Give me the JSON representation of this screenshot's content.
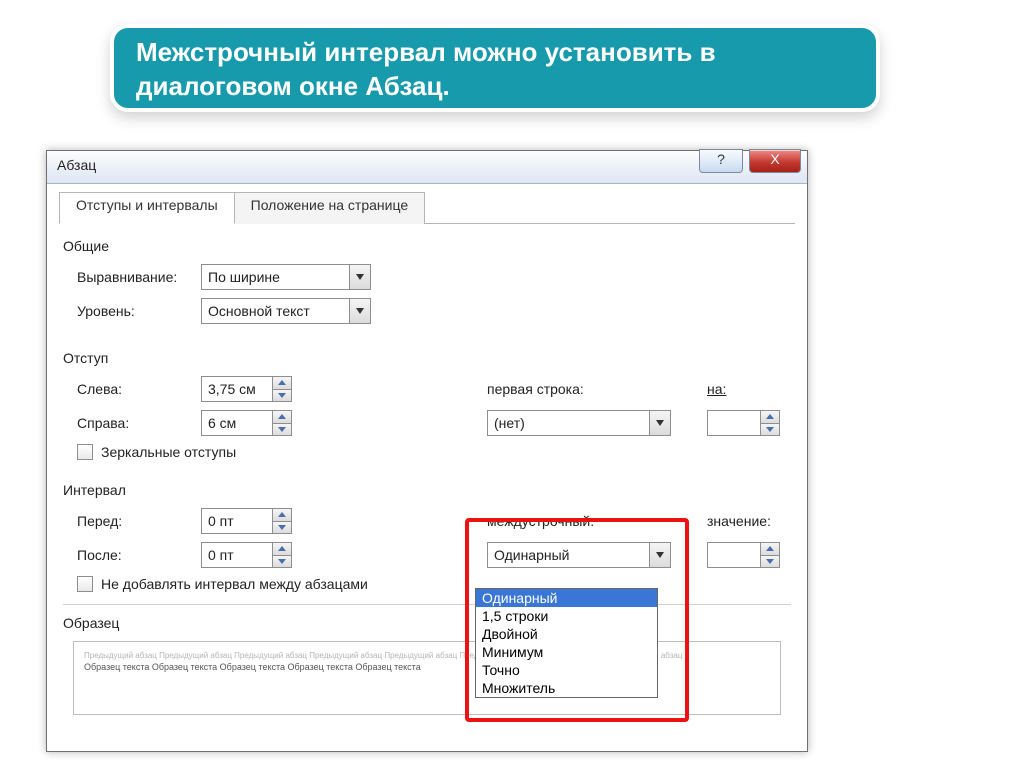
{
  "banner": {
    "text": "Межстрочный интервал можно установить в диалоговом окне Абзац."
  },
  "dialog": {
    "title": "Абзац",
    "help_symbol": "?",
    "close_symbol": "X",
    "tabs": {
      "active": "Отступы и интервалы",
      "other": "Положение на странице"
    },
    "general": {
      "title": "Общие",
      "align_label": "Выравнивание:",
      "align_value": "По ширине",
      "level_label": "Уровень:",
      "level_value": "Основной текст"
    },
    "indent": {
      "title": "Отступ",
      "left_label": "Слева:",
      "left_value": "3,75 см",
      "right_label": "Справа:",
      "right_value": "6 см",
      "firstline_label": "первая строка:",
      "firstline_value": "(нет)",
      "by_label": "на:",
      "by_value": "",
      "mirror_label": "Зеркальные отступы"
    },
    "spacing": {
      "title": "Интервал",
      "before_label": "Перед:",
      "before_value": "0 пт",
      "after_label": "После:",
      "after_value": "0 пт",
      "between_label": "междустрочный:",
      "between_value": "Одинарный",
      "value_label": "значение:",
      "value_value": "",
      "noadd_label": "Не добавлять интервал между абзацами",
      "options": [
        "Одинарный",
        "1,5 строки",
        "Двойной",
        "Минимум",
        "Точно",
        "Множитель"
      ],
      "selected": "Одинарный"
    },
    "preview": {
      "title": "Образец",
      "faint": "Предыдущий  абзац  Предыдущий  абзац  Предыдущий  абзац  Предыдущий  абзац  Предыдущий  абзац  Предыдущий  абзац  Предыдущий  абзац  Предыдущий  абзац",
      "sample": "Образец текста Образец текста Образец текста Образец текста Образец текста"
    }
  }
}
